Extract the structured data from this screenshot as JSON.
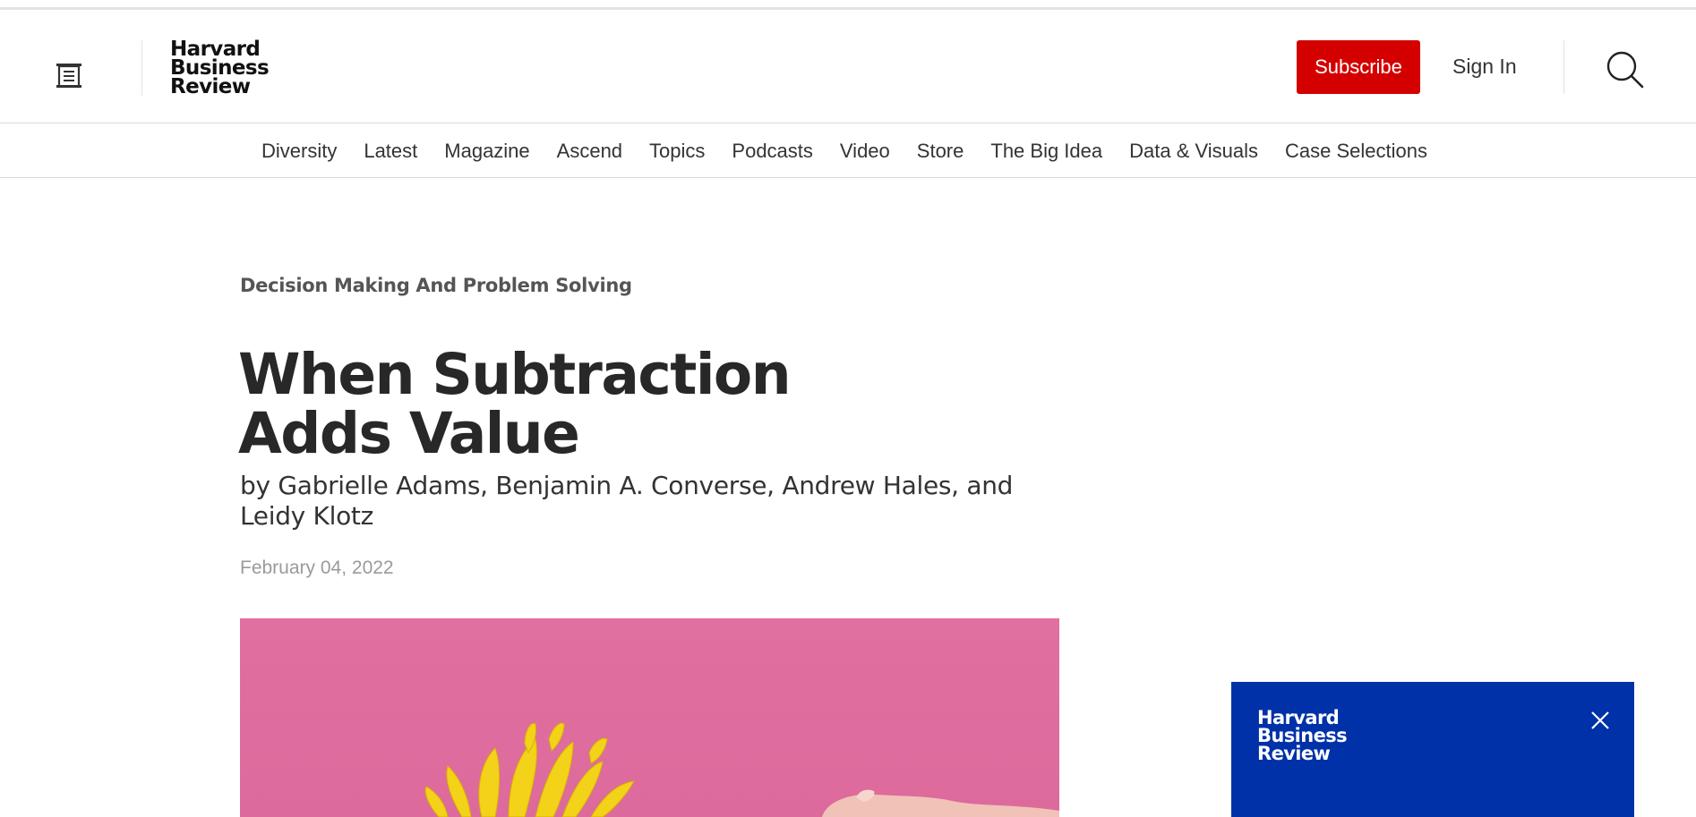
{
  "header": {
    "logo_lines": [
      "Harvard",
      "Business",
      "Review"
    ],
    "subscribe_label": "Subscribe",
    "signin_label": "Sign In"
  },
  "nav": {
    "items": [
      "Diversity",
      "Latest",
      "Magazine",
      "Ascend",
      "Topics",
      "Podcasts",
      "Video",
      "Store",
      "The Big Idea",
      "Data & Visuals",
      "Case Selections"
    ]
  },
  "article": {
    "topic": "Decision Making And Problem Solving",
    "title": "When Subtraction Adds Value",
    "byline": "by Gabrielle Adams, Benjamin A. Converse, Andrew Hales, and Leidy Klotz",
    "date": "February 04, 2022"
  },
  "promo": {
    "logo_lines": [
      "Harvard",
      "Business",
      "Review"
    ]
  },
  "icons": {
    "menu": "menu-icon",
    "search": "search-icon",
    "close": "close-icon"
  },
  "colors": {
    "subscribe_bg": "#d40000",
    "promo_bg": "#0031a8",
    "hero_bg": "#e070a0"
  }
}
